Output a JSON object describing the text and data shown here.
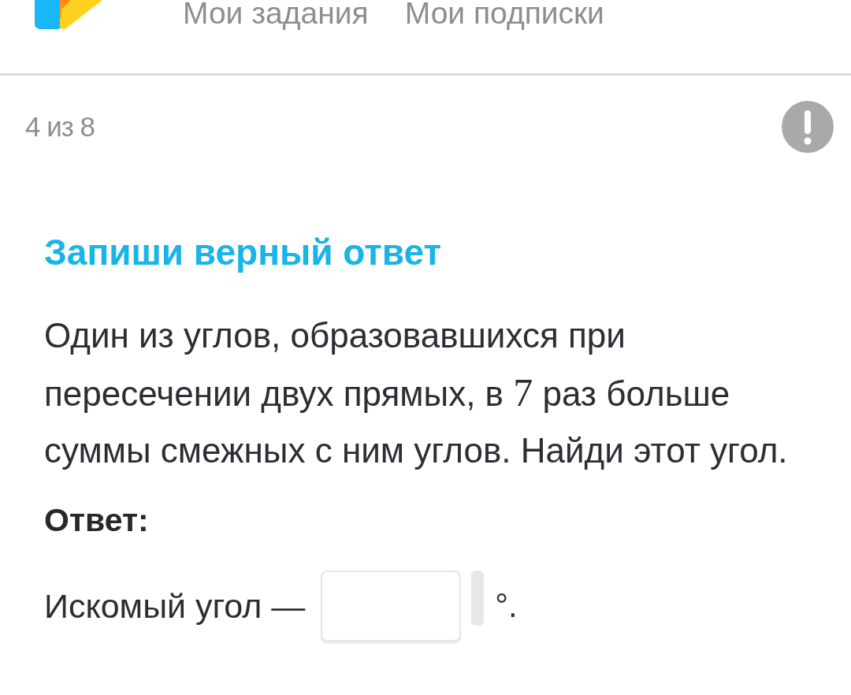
{
  "header": {
    "nav": [
      {
        "label": "Мои задания"
      },
      {
        "label": "Мои подписки"
      }
    ]
  },
  "task": {
    "counter": "4 из 8",
    "title": "Запиши верный ответ",
    "question": [
      {
        "kind": "text",
        "text": "Один из углов, образовавшихся при пересечении двух прямых, в "
      },
      {
        "kind": "math",
        "text": "7"
      },
      {
        "kind": "text",
        "text": " раз больше суммы смежных с ним углов. Найди этот угол."
      }
    ],
    "answer_label": "Ответ:",
    "answer": {
      "prefix": "Искомый угол —",
      "suffix": "°."
    }
  }
}
